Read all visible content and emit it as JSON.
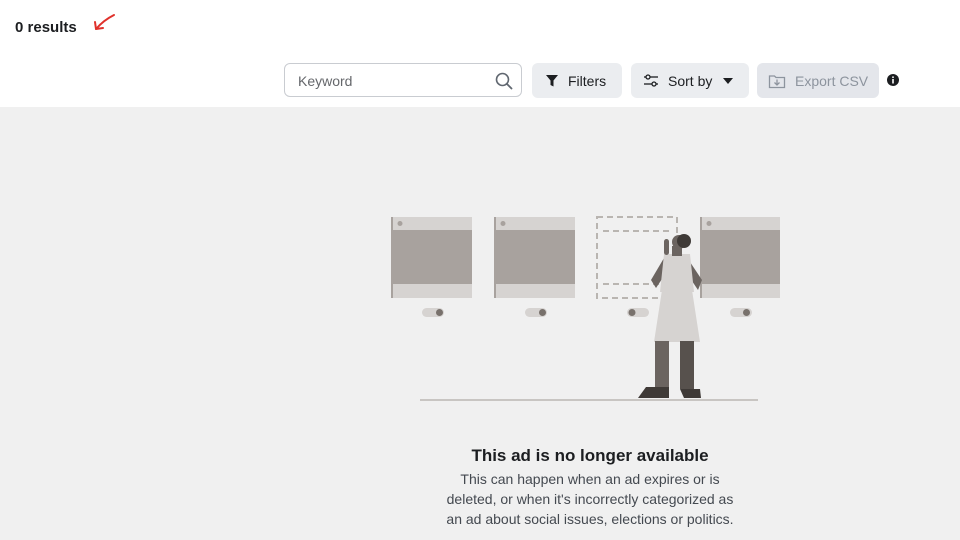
{
  "header": {
    "results_count": "0 results"
  },
  "toolbar": {
    "search": {
      "placeholder": "Keyword",
      "value": ""
    },
    "filters_label": "Filters",
    "sort_label": "Sort by",
    "export_label": "Export CSV",
    "export_disabled": true
  },
  "empty_state": {
    "title": "This ad is no longer available",
    "description": "This can happen when an ad expires or is deleted, or when it's incorrectly categorized as an ad about social issues, elections or politics."
  },
  "icons": {
    "search": "search-icon",
    "filters": "filter-icon",
    "sort": "sliders-icon",
    "sort_caret": "caret-down-icon",
    "export": "download-icon",
    "info": "info-icon",
    "annotation": "red-arrow-icon"
  },
  "colors": {
    "annotation": "#e0312b",
    "button_bg": "#ebedf0",
    "content_bg": "#f0f0f0",
    "illustration_panel": "#a8a29e"
  }
}
